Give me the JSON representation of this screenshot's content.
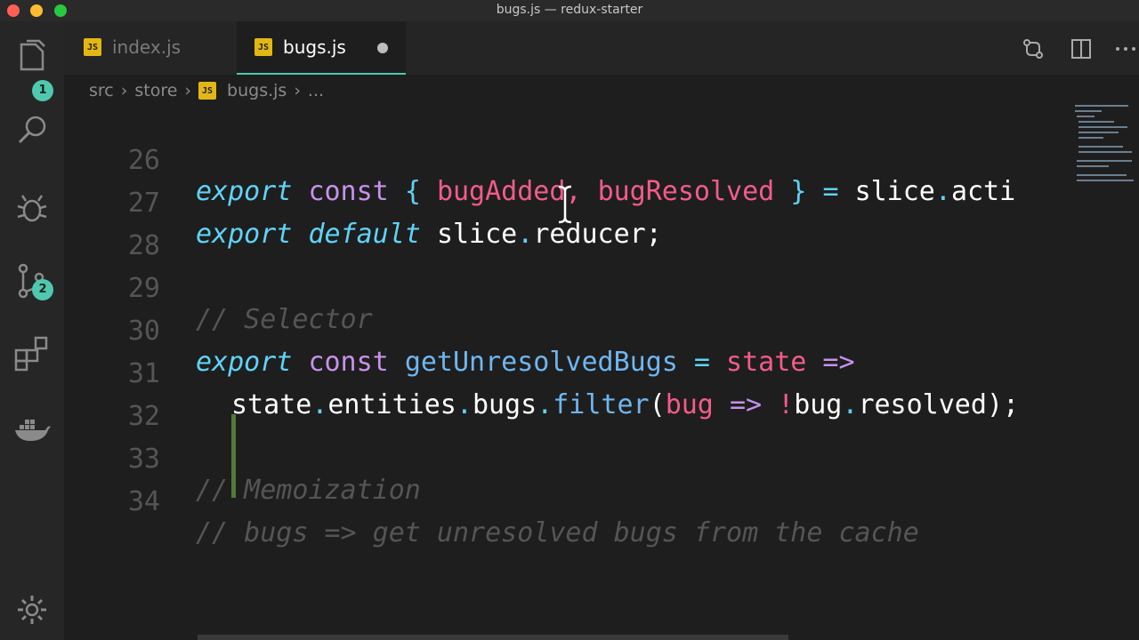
{
  "window": {
    "title": "bugs.js — redux-starter"
  },
  "activity_bar": {
    "explorer_badge": "1",
    "scm_badge": "2",
    "icons": [
      "files-icon",
      "search-icon",
      "debug-icon",
      "source-control-icon",
      "extensions-icon",
      "docker-icon",
      "settings-gear-icon"
    ]
  },
  "tabs": [
    {
      "label": "index.js",
      "icon": "JS",
      "active": false
    },
    {
      "label": "bugs.js",
      "icon": "JS",
      "active": true,
      "dirty": true
    }
  ],
  "breadcrumb": {
    "parts": [
      "src",
      "store",
      "bugs.js",
      "..."
    ],
    "file_icon": "JS"
  },
  "editor": {
    "lines": [
      {
        "n": "26",
        "tokens": [
          "export",
          "const",
          "{",
          "bugAdded",
          ",",
          "bugResolved",
          "}",
          "=",
          "slice",
          ".",
          "acti"
        ]
      },
      {
        "n": "27",
        "tokens": [
          "export",
          "default",
          "slice",
          ".",
          "reducer;"
        ]
      },
      {
        "n": "28",
        "tokens": []
      },
      {
        "n": "29",
        "tokens": [
          "// Selector"
        ]
      },
      {
        "n": "30",
        "tokens": [
          "export",
          "const",
          "getUnresolvedBugs",
          "=",
          "state",
          "=>"
        ]
      },
      {
        "n": "31",
        "tokens": [
          "state",
          ".",
          "entities",
          ".",
          "bugs",
          ".",
          "filter",
          "(",
          "bug",
          "=>",
          "!",
          "bug",
          ".",
          "resolved",
          ");"
        ]
      },
      {
        "n": "32",
        "tokens": []
      },
      {
        "n": "33",
        "tokens": [
          "// Memoization"
        ]
      },
      {
        "n": "34",
        "tokens": [
          "// bugs => get unresolved bugs from the cache"
        ]
      }
    ]
  },
  "colors": {
    "keyword_italic": "#5fd3f5",
    "keyword": "#c792ea",
    "variable_red": "#f25c8a",
    "function": "#6fb6f0",
    "comment": "#555555",
    "accent": "#4ec9b0"
  }
}
